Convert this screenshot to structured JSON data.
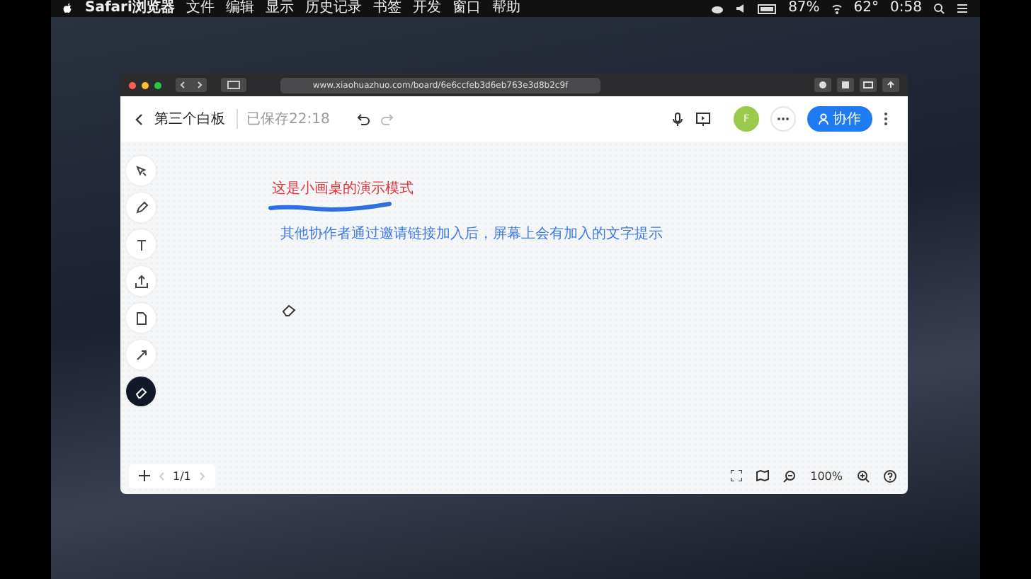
{
  "menu_bar": {
    "app": "Safari浏览器",
    "items": [
      "文件",
      "编辑",
      "显示",
      "历史记录",
      "书签",
      "开发",
      "窗口",
      "帮助"
    ],
    "battery": "87%",
    "temperature": "62°",
    "time": "0:58"
  },
  "browser": {
    "url": "www.xiaohuazhuo.com/board/6e6ccfeb3d6eb763e3d8b2c9f"
  },
  "board": {
    "title": "第三个白板",
    "saved": "已保存22:18",
    "avatar": "F",
    "share_button": "协作"
  },
  "tools": [
    {
      "kind": "select",
      "selected": false
    },
    {
      "kind": "pen",
      "selected": false
    },
    {
      "kind": "text",
      "selected": false
    },
    {
      "kind": "upload",
      "selected": false
    },
    {
      "kind": "file",
      "selected": false
    },
    {
      "kind": "arrow",
      "selected": false
    },
    {
      "kind": "eraser",
      "selected": true
    }
  ],
  "canvas": {
    "heading": "这是小画桌的演示模式",
    "note": "其他协作者通过邀请链接加入后，屏幕上会有加入的文字提示"
  },
  "footer": {
    "page": "1/1",
    "zoom": "100%"
  }
}
